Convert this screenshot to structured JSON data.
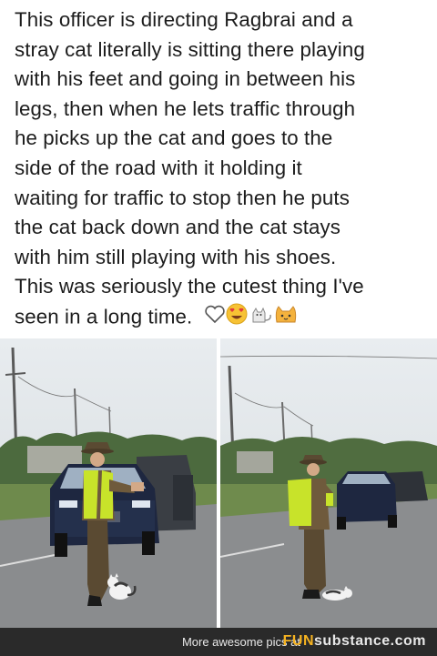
{
  "post": {
    "lines": [
      "This officer is directing Ragbrai and a",
      "stray cat literally is sitting there playing",
      "with his feet and going in between his",
      "legs, then when he lets traffic through",
      "he picks up the cat and goes to the",
      "side of the road with it holding it",
      "waiting for traffic to stop then he puts",
      "the cat back down and the cat stays",
      "with him still playing with his shoes.",
      "This was seriously the cutest thing I've",
      "seen in a long time."
    ],
    "emojis": [
      "heart-outline-icon",
      "heart-eyes-face-icon",
      "cat-icon",
      "cat-face-icon"
    ]
  },
  "photos": [
    {
      "name": "officer-holding-cat-photo"
    },
    {
      "name": "officer-cat-on-road-photo"
    }
  ],
  "footer": {
    "caption": "More awesome pics at",
    "brand_prefix": "FUN",
    "brand_suffix": "substance.com"
  },
  "colors": {
    "text": "#1c1c1c",
    "vest": "#c8e32a",
    "footer_bg": "#2a2a2a",
    "brand_accent": "#f6b321"
  }
}
